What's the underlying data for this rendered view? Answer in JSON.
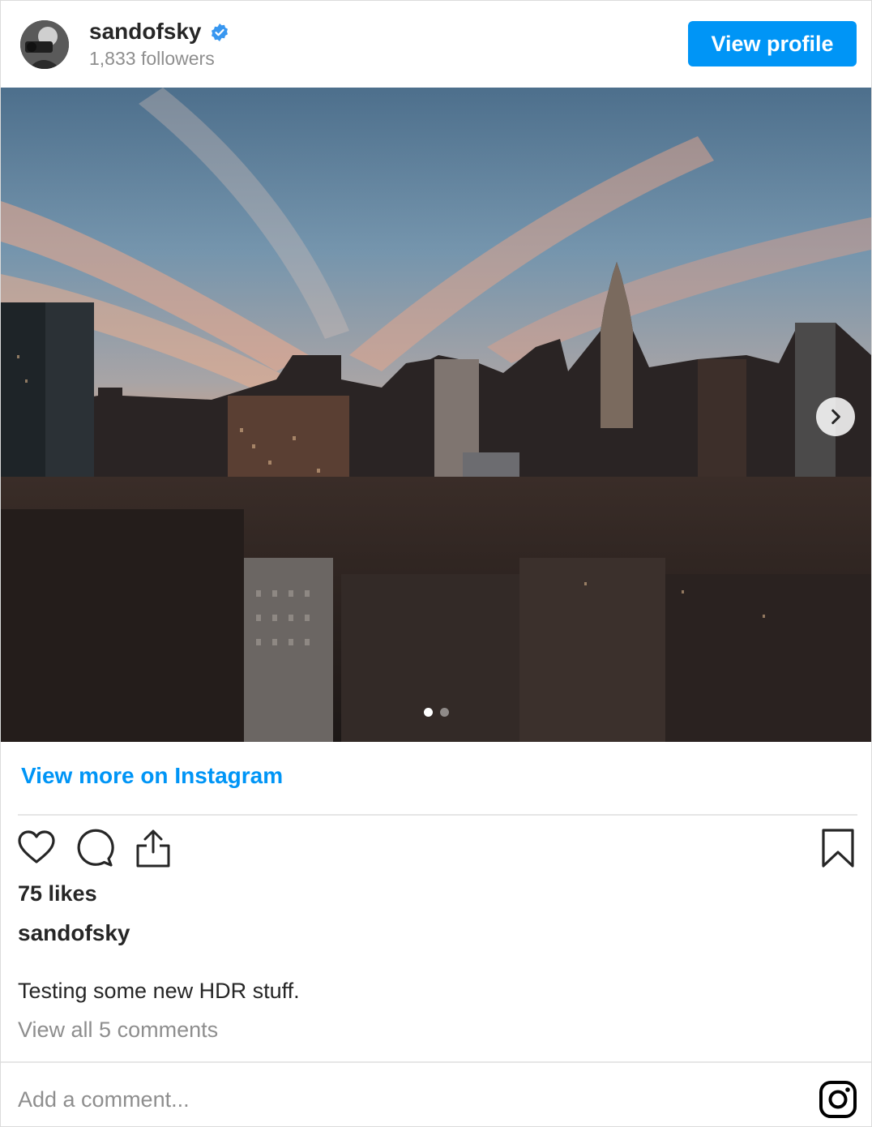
{
  "header": {
    "username": "sandofsky",
    "verified": true,
    "followers": "1,833 followers",
    "view_profile_label": "View profile",
    "accent_color": "#0095f6"
  },
  "post": {
    "image_description_icon": "photo-city-skyline",
    "carousel": {
      "total": 2,
      "current": 1
    },
    "next_icon": "chevron-right-icon"
  },
  "links": {
    "view_more": "View more on Instagram"
  },
  "actions": {
    "icons": [
      "heart-icon",
      "comment-icon",
      "share-icon",
      "bookmark-icon"
    ]
  },
  "engagement": {
    "likes": "75 likes",
    "caption_user": "sandofsky",
    "caption_text": "Testing some new HDR stuff.",
    "view_comments": "View all 5 comments"
  },
  "comment": {
    "placeholder": "Add a comment..."
  }
}
